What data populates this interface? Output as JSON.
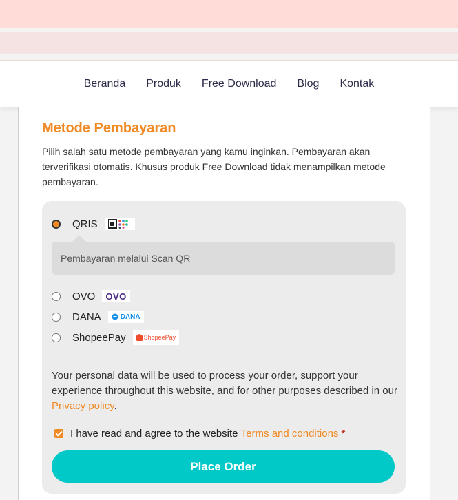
{
  "nav": {
    "items": [
      "Beranda",
      "Produk",
      "Free Download",
      "Blog",
      "Kontak"
    ]
  },
  "payment": {
    "title": "Metode Pembayaran",
    "description": "Pilih salah satu metode pembayaran yang kamu inginkan. Pembayaran akan terverifikasi otomatis. Khusus produk Free Download tidak menampilkan metode pembayaran.",
    "methods": [
      {
        "label": "QRIS",
        "logo": "QRIS",
        "selected": true
      },
      {
        "label": "OVO",
        "logo": "OVO",
        "selected": false
      },
      {
        "label": "DANA",
        "logo": "DANA",
        "selected": false
      },
      {
        "label": "ShopeePay",
        "logo": "ShopeePay",
        "selected": false
      }
    ],
    "qris_note": "Pembayaran melalui Scan QR"
  },
  "privacy": {
    "text": "Your personal data will be used to process your order, support your experience throughout this website, and for other purposes described in our",
    "link": "Privacy policy",
    "end": "."
  },
  "terms": {
    "text": "I have read and agree to the website",
    "link": "Terms and conditions",
    "required": "*",
    "checked": true
  },
  "place_order": "Place Order",
  "colors": {
    "accent": "#f08a24",
    "button": "#00c9c8",
    "topbar": "#ffdcd7"
  }
}
